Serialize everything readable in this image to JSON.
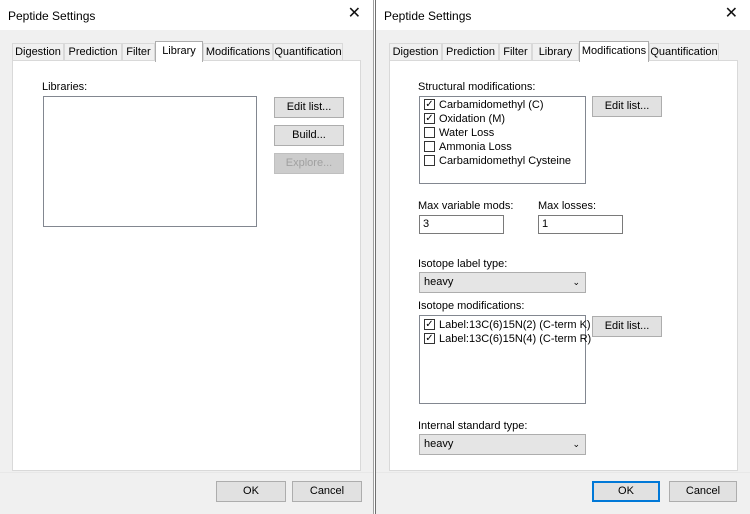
{
  "left_dialog": {
    "title": "Peptide Settings",
    "close_glyph": "✕",
    "tabs": [
      {
        "label": "Digestion"
      },
      {
        "label": "Prediction"
      },
      {
        "label": "Filter"
      },
      {
        "label": "Library"
      },
      {
        "label": "Modifications"
      },
      {
        "label": "Quantification"
      }
    ],
    "active_tab": "Library",
    "libraries_label": "Libraries:",
    "edit_list_button": "Edit list...",
    "build_button": "Build...",
    "explore_button": "Explore...",
    "ok_button": "OK",
    "cancel_button": "Cancel"
  },
  "right_dialog": {
    "title": "Peptide Settings",
    "close_glyph": "✕",
    "tabs": [
      {
        "label": "Digestion"
      },
      {
        "label": "Prediction"
      },
      {
        "label": "Filter"
      },
      {
        "label": "Library"
      },
      {
        "label": "Modifications"
      },
      {
        "label": "Quantification"
      }
    ],
    "active_tab": "Modifications",
    "structural_label": "Structural modifications:",
    "structural_items": [
      {
        "label": "Carbamidomethyl (C)",
        "checked": true
      },
      {
        "label": "Oxidation (M)",
        "checked": true
      },
      {
        "label": "Water Loss",
        "checked": false
      },
      {
        "label": "Ammonia Loss",
        "checked": false
      },
      {
        "label": "Carbamidomethyl Cysteine",
        "checked": false
      }
    ],
    "edit_list_button": "Edit list...",
    "max_variable_mods_label": "Max variable mods:",
    "max_variable_mods_value": "3",
    "max_losses_label": "Max losses:",
    "max_losses_value": "1",
    "isotope_label_type_label": "Isotope label type:",
    "isotope_label_type_value": "heavy",
    "isotope_mods_label": "Isotope modifications:",
    "isotope_items": [
      {
        "label": "Label:13C(6)15N(2) (C-term K)",
        "checked": true
      },
      {
        "label": "Label:13C(6)15N(4) (C-term R)",
        "checked": true
      }
    ],
    "isotope_edit_list_button": "Edit list...",
    "internal_standard_label": "Internal standard type:",
    "internal_standard_value": "heavy",
    "ok_button": "OK",
    "cancel_button": "Cancel",
    "check_glyph": "✓",
    "chevron_glyph": "⌄"
  }
}
